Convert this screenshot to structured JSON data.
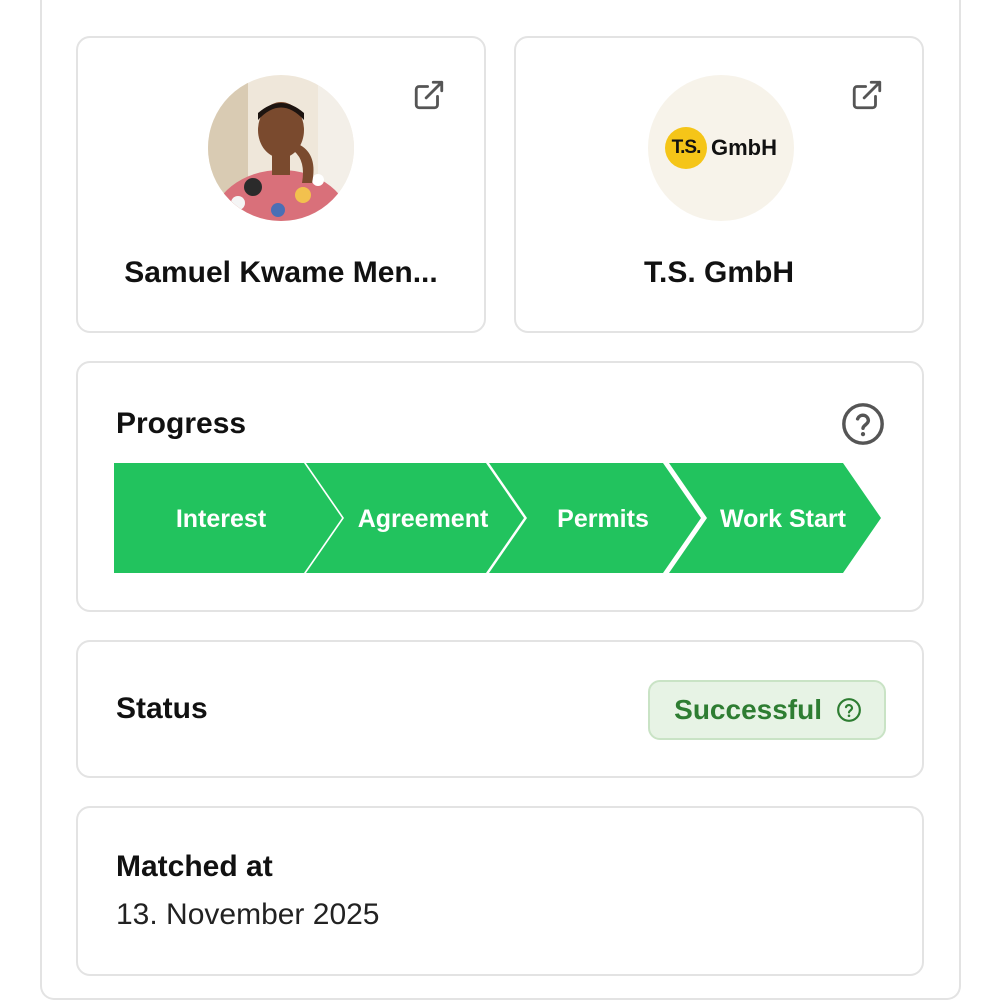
{
  "person": {
    "name": "Samuel Kwame Men...",
    "avatar_icon": "person-photo",
    "link_icon": "external-link-icon"
  },
  "company": {
    "name": "T.S. GmbH",
    "logo_mark": "T.S.",
    "logo_text": "GmbH",
    "logo_color": "#f5c518",
    "link_icon": "external-link-icon"
  },
  "progress": {
    "title": "Progress",
    "help_icon": "question-circle-icon",
    "accent": "#22c35e",
    "steps": [
      {
        "label": "Interest"
      },
      {
        "label": "Agreement"
      },
      {
        "label": "Permits"
      },
      {
        "label": "Work Start"
      }
    ]
  },
  "status": {
    "title": "Status",
    "badge_label": "Successful",
    "badge_color": "#2e7d32",
    "badge_icon": "question-circle-icon"
  },
  "matched": {
    "title": "Matched at",
    "date": "13. November 2025"
  }
}
